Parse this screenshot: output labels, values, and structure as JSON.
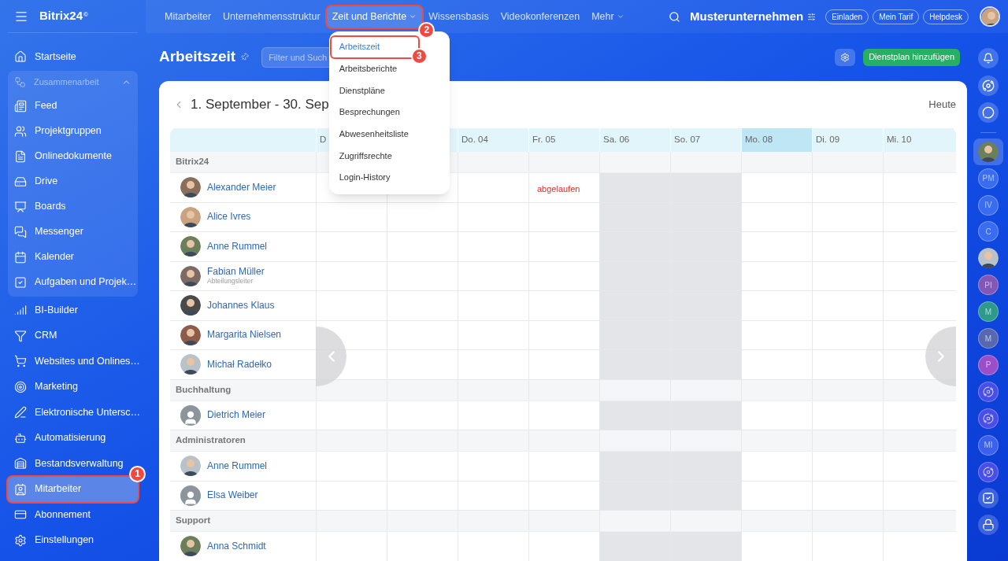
{
  "logo": {
    "text": "Bitrix24",
    "mark": "©"
  },
  "sidebar": {
    "items": [
      {
        "label": "Startseite",
        "selected": false
      },
      {
        "label": "Zusammenarbeit",
        "expanded": true,
        "children": [
          {
            "label": "Feed",
            "selected": false
          },
          {
            "label": "Projektgruppen",
            "selected": false
          },
          {
            "label": "Onlinedokumente",
            "selected": false
          },
          {
            "label": "Drive",
            "selected": false
          },
          {
            "label": "Boards",
            "selected": false
          },
          {
            "label": "Messenger",
            "selected": false
          },
          {
            "label": "Kalender",
            "selected": false
          },
          {
            "label": "Aufgaben und Projek…",
            "selected": false
          }
        ]
      },
      {
        "label": "BI-Builder",
        "selected": false
      },
      {
        "label": "CRM",
        "selected": false
      },
      {
        "label": "Websites und Onlines…",
        "selected": false
      },
      {
        "label": "Marketing",
        "selected": false
      },
      {
        "label": "Elektronische Untersc…",
        "selected": false
      },
      {
        "label": "Automatisierung",
        "selected": false
      },
      {
        "label": "Bestandsverwaltung",
        "selected": false
      },
      {
        "label": "Mitarbeiter",
        "selected": true,
        "callout": "1"
      },
      {
        "label": "Abonnement",
        "selected": false
      },
      {
        "label": "Einstellungen",
        "selected": false
      }
    ]
  },
  "top_nav": {
    "items": [
      {
        "label": "Mitarbeiter",
        "selected": false
      },
      {
        "label": "Unternehmensstruktur",
        "selected": false
      },
      {
        "label": "Zeit und Berichte",
        "selected": true,
        "has_caret": true,
        "callout": "2",
        "expanded": true,
        "menu": [
          {
            "label": "Arbeitszeit",
            "selected": true,
            "callout": "3"
          },
          {
            "label": "Arbeitsberichte",
            "selected": false
          },
          {
            "label": "Dienstpläne",
            "selected": false
          },
          {
            "label": "Besprechungen",
            "selected": false
          },
          {
            "label": "Abwesenheitsliste",
            "selected": false
          },
          {
            "label": "Zugriffsrechte",
            "selected": false
          },
          {
            "label": "Login-History",
            "selected": false
          }
        ]
      },
      {
        "label": "Wissensbasis",
        "selected": false
      },
      {
        "label": "Videokonferenzen",
        "selected": false
      },
      {
        "label": "Mehr",
        "selected": false,
        "has_caret": true
      }
    ],
    "company": "Musterunternehmen",
    "buttons": [
      "Einladen",
      "Mein Tarif",
      "Helpdesk"
    ]
  },
  "page": {
    "title": "Arbeitszeit",
    "filter_placeholder": "Filter und Such",
    "add_button": "Dienstplan hinzufügen"
  },
  "calendar": {
    "range": "1. September - 30. Sep",
    "today_button": "Heute",
    "days": [
      {
        "label": "D",
        "weekend": false,
        "selected": false
      },
      {
        "weekend": false,
        "selected": false
      },
      {
        "label": "Do. 04",
        "weekend": false,
        "selected": false
      },
      {
        "label": "Fr. 05",
        "weekend": false,
        "selected": false
      },
      {
        "label": "Sa. 06",
        "weekend": true,
        "selected": false
      },
      {
        "label": "So. 07",
        "weekend": true,
        "selected": false
      },
      {
        "label": "Mo. 08",
        "weekend": false,
        "selected": true
      },
      {
        "label": "Di. 09",
        "weekend": false,
        "selected": false
      },
      {
        "label": "Mi. 10",
        "weekend": false,
        "selected": false
      }
    ],
    "groups": [
      {
        "name": "Bitrix24",
        "members": [
          {
            "name": "Alexander Meier",
            "cells": [
              null,
              null,
              null,
              {
                "text": "abgelaufen",
                "kind": "expired"
              }
            ]
          },
          {
            "name": "Alice Ivres"
          },
          {
            "name": "Anne Rummel"
          },
          {
            "name": "Fabian Müller",
            "role": "Abteilungsleiter"
          },
          {
            "name": "Johannes Klaus"
          },
          {
            "name": "Margarita Nielsen"
          },
          {
            "name": "Michał Radełko"
          }
        ]
      },
      {
        "name": "Buchhaltung",
        "members": [
          {
            "name": "Dietrich Meier",
            "kind": "default"
          }
        ]
      },
      {
        "name": "Administratoren",
        "members": [
          {
            "name": "Anne Rummel"
          },
          {
            "name": "Elsa Weiber",
            "kind": "default"
          }
        ]
      },
      {
        "name": "Support",
        "members": [
          {
            "name": "Anna Schmidt"
          }
        ]
      }
    ]
  },
  "right_bar": {
    "items": [
      {
        "kind": "avatar",
        "selected": true
      },
      {
        "kind": "initials",
        "text": "PM",
        "color": "#3a6cf0",
        "selected": false
      },
      {
        "kind": "initials",
        "text": "IV",
        "color": "#3a6cf0",
        "selected": false
      },
      {
        "kind": "initials",
        "text": "C",
        "color": "#3a6cf0",
        "selected": false
      },
      {
        "kind": "avatar",
        "selected": false
      },
      {
        "kind": "initials",
        "text": "PI",
        "color": "#8257b8",
        "selected": false
      },
      {
        "kind": "initials",
        "text": "M",
        "color": "#2d9a8c",
        "selected": false
      },
      {
        "kind": "initials",
        "text": "M",
        "color": "#5868b0",
        "selected": false
      },
      {
        "kind": "initials",
        "text": "P",
        "color": "#9a4fc9",
        "selected": false
      },
      {
        "kind": "channel",
        "selected": false
      },
      {
        "kind": "channel",
        "selected": false
      },
      {
        "kind": "initials",
        "text": "MI",
        "color": "#3a60ee",
        "selected": false
      },
      {
        "kind": "channel",
        "selected": false
      },
      {
        "kind": "tasks",
        "selected": false
      },
      {
        "kind": "lock",
        "selected": false
      }
    ]
  }
}
